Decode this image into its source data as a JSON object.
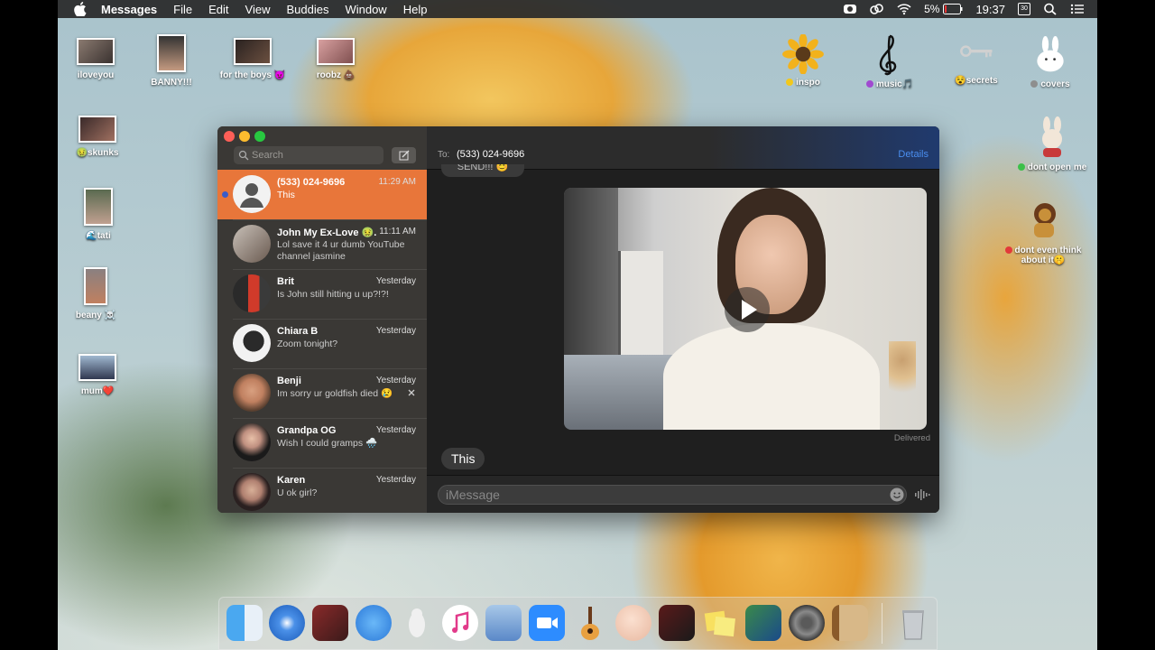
{
  "menubar": {
    "app": "Messages",
    "items": [
      "File",
      "Edit",
      "View",
      "Buddies",
      "Window",
      "Help"
    ],
    "battery": "5%",
    "time": "19:37",
    "calendar_day": "30"
  },
  "desktop": {
    "icons_left": [
      {
        "label": "iloveyou",
        "tag": null
      },
      {
        "label": "BANNY!!!",
        "tag": null
      },
      {
        "label": "for the boys 😈",
        "tag": null
      },
      {
        "label": "roobz 💩",
        "tag": null
      },
      {
        "label": "skunks",
        "tag": "🤢"
      },
      {
        "label": "tati",
        "tag": "🌊"
      },
      {
        "label": "beany ☠️",
        "tag": null
      },
      {
        "label": "mum❤️",
        "tag": null
      }
    ],
    "icons_right": [
      {
        "label": "inspo",
        "dot": "#f2c81c"
      },
      {
        "label": "music🎵",
        "dot": "#a04ad0"
      },
      {
        "label": "secrets",
        "prefix": "😵"
      },
      {
        "label": "covers",
        "dot": "#8e8e8e"
      },
      {
        "label": "dont open me",
        "dot": "#3cc04a"
      },
      {
        "label": "dont even think about it🤫",
        "dot": "#e23a3a"
      }
    ]
  },
  "sidebar": {
    "search_placeholder": "Search",
    "conversations": [
      {
        "name": "(533) 024-9696",
        "time": "11:29 AM",
        "preview": "This",
        "active": true,
        "unread": true
      },
      {
        "name": "John My Ex-Love 🤢...",
        "time": "11:11 AM",
        "preview": "Lol save it 4 ur dumb YouTube channel jasmine"
      },
      {
        "name": "Brit",
        "time": "Yesterday",
        "preview": "Is John still hitting u up?!?!"
      },
      {
        "name": "Chiara B",
        "time": "Yesterday",
        "preview": "Zoom tonight?"
      },
      {
        "name": "Benji",
        "time": "Yesterday",
        "preview": "Im sorry ur goldfish died 😢"
      },
      {
        "name": "Grandpa OG",
        "time": "Yesterday",
        "preview": "Wish I could gramps 🌧️"
      },
      {
        "name": "Karen",
        "time": "Yesterday",
        "preview": "U ok girl?"
      }
    ]
  },
  "chat": {
    "to_label": "To:",
    "recipient": "(533) 024-9696",
    "details_label": "Details",
    "prev_bubble_text": "SEND!!! 😊",
    "delivered_label": "Delivered",
    "last_message": "This",
    "input_placeholder": "iMessage"
  },
  "dock": {
    "apps": [
      "finder-icon",
      "safari-icon",
      "photo-booth-icon",
      "messages-icon",
      "vectornator-icon",
      "itunes-icon",
      "seal-icon",
      "zoom-icon",
      "garageband-icon",
      "face-icon",
      "photo-app-icon",
      "stickies-icon",
      "preview-icon",
      "system-preferences-icon",
      "contacts-icon",
      "trash-icon"
    ]
  },
  "colors": {
    "active_convo": "#e8763a",
    "details_link": "#4a8ef0",
    "unread_dot": "#3a5cc8"
  }
}
